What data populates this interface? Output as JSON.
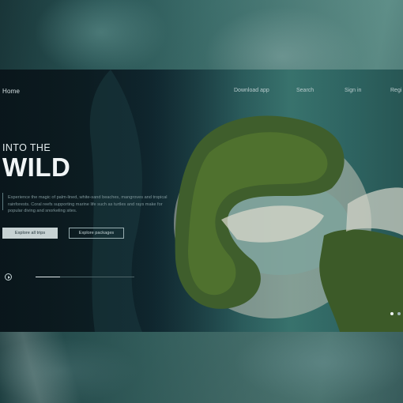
{
  "nav": {
    "home": "Home",
    "links": [
      "Download app",
      "Search",
      "Sign in",
      "Regi"
    ]
  },
  "hero": {
    "eyebrow": "INTO THE",
    "title": "WILD",
    "description": "Experience the magic of palm-lined, white-sand beaches, mangroves and tropical rainforests. Coral reefs supporting marine life such as turtles and rays make for popular diving and snorkeling sites.",
    "primary_button": "Explore all trips",
    "secondary_button": "Explore packages"
  },
  "player": {
    "icon": "play-icon",
    "progress": 0.25
  },
  "slider": {
    "count": 2,
    "active_index": 0
  },
  "colors": {
    "primary_button_bg": "#c7d2d3",
    "title_text": "#f1f5f6",
    "water_teal": "#3a7670",
    "foliage_green": "#4a6f2f"
  }
}
